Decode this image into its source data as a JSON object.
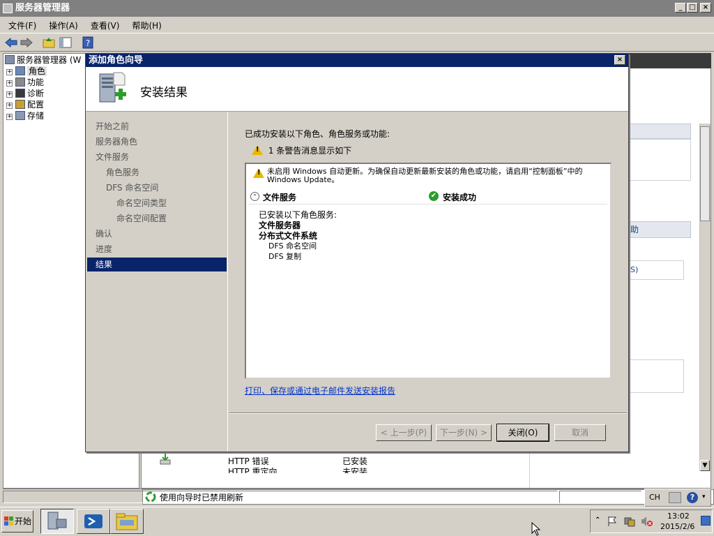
{
  "window": {
    "title": "服务器管理器"
  },
  "menu": [
    "文件(F)",
    "操作(A)",
    "查看(V)",
    "帮助(H)"
  ],
  "tree": {
    "root": "服务器管理器 (W",
    "items": [
      "角色",
      "功能",
      "诊断",
      "配置",
      "存储"
    ]
  },
  "background": {
    "row1_name": "HTTP 错误",
    "row1_status": "已安装",
    "row2_name": "HTTP 重定向",
    "row2_status": "未安装",
    "side_text1": "助",
    "side_text2": "S)"
  },
  "status": {
    "text": "使用向导时已禁用刷新"
  },
  "dialog": {
    "title": "添加角色向导",
    "header": "安装结果",
    "nav": [
      "开始之前",
      "服务器角色",
      "文件服务",
      "角色服务",
      "DFS 命名空间",
      "命名空间类型",
      "命名空间配置",
      "确认",
      "进度",
      "结果"
    ],
    "nav_selected": 9,
    "intro": "已成功安装以下角色、角色服务或功能:",
    "warning_count": "1 条警告消息显示如下",
    "box": {
      "warning": "未启用 Windows 自动更新。为确保自动更新最新安装的角色或功能，请启用“控制面板”中的 Windows Update。",
      "section": "文件服务",
      "result": "安装成功",
      "installed_label": "已安装以下角色服务:",
      "lines": [
        {
          "text": "文件服务器",
          "bold": true,
          "indent": 0
        },
        {
          "text": "分布式文件系统",
          "bold": true,
          "indent": 0
        },
        {
          "text": "DFS 命名空间",
          "bold": false,
          "indent": 1
        },
        {
          "text": "DFS 复制",
          "bold": false,
          "indent": 1
        }
      ]
    },
    "link": "打印、保存或通过电子邮件发送安装报告",
    "buttons": {
      "prev": "< 上一步(P)",
      "next": "下一步(N) >",
      "close": "关闭(O)",
      "cancel": "取消"
    }
  },
  "taskbar": {
    "start": "开始",
    "tray_lang": "CH",
    "time": "13:02",
    "date": "2015/2/6"
  },
  "colors": {
    "accent": "#0a246a",
    "success": "#2a9d2a",
    "warning": "#e6b800",
    "link": "#0033cc"
  }
}
